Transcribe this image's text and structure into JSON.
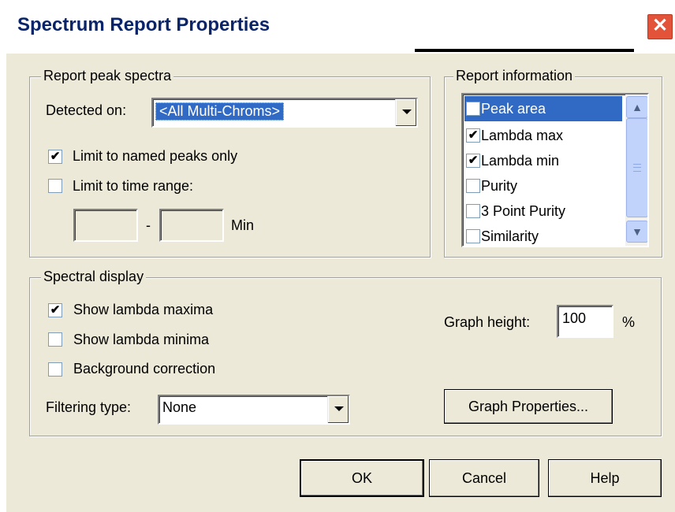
{
  "window": {
    "title": "Spectrum Report Properties",
    "close_symbol": "✕"
  },
  "report_peak_spectra": {
    "group_label": "Report peak spectra",
    "detected_on_label": "Detected on:",
    "detected_on_value": "<All Multi-Chroms>",
    "limit_named_label": "Limit to named peaks only",
    "limit_named_checked": true,
    "limit_time_label": "Limit to time range:",
    "limit_time_checked": false,
    "range_from": "",
    "range_to": "",
    "range_separator": "-",
    "range_unit": "Min"
  },
  "report_information": {
    "group_label": "Report information",
    "items": [
      {
        "label": "Peak area",
        "checked": false,
        "selected": true
      },
      {
        "label": "Lambda max",
        "checked": true,
        "selected": false
      },
      {
        "label": "Lambda min",
        "checked": true,
        "selected": false
      },
      {
        "label": "Purity",
        "checked": false,
        "selected": false
      },
      {
        "label": "3 Point Purity",
        "checked": false,
        "selected": false
      },
      {
        "label": "Similarity",
        "checked": false,
        "selected": false
      }
    ]
  },
  "spectral_display": {
    "group_label": "Spectral display",
    "show_maxima_label": "Show lambda maxima",
    "show_maxima_checked": true,
    "show_minima_label": "Show lambda minima",
    "show_minima_checked": false,
    "background_label": "Background correction",
    "background_checked": false,
    "filtering_label": "Filtering type:",
    "filtering_value": "None",
    "graph_height_label": "Graph height:",
    "graph_height_value": "100",
    "graph_height_unit": "%",
    "graph_properties_label": "Graph Properties..."
  },
  "footer": {
    "ok_label": "OK",
    "cancel_label": "Cancel",
    "help_label": "Help"
  }
}
